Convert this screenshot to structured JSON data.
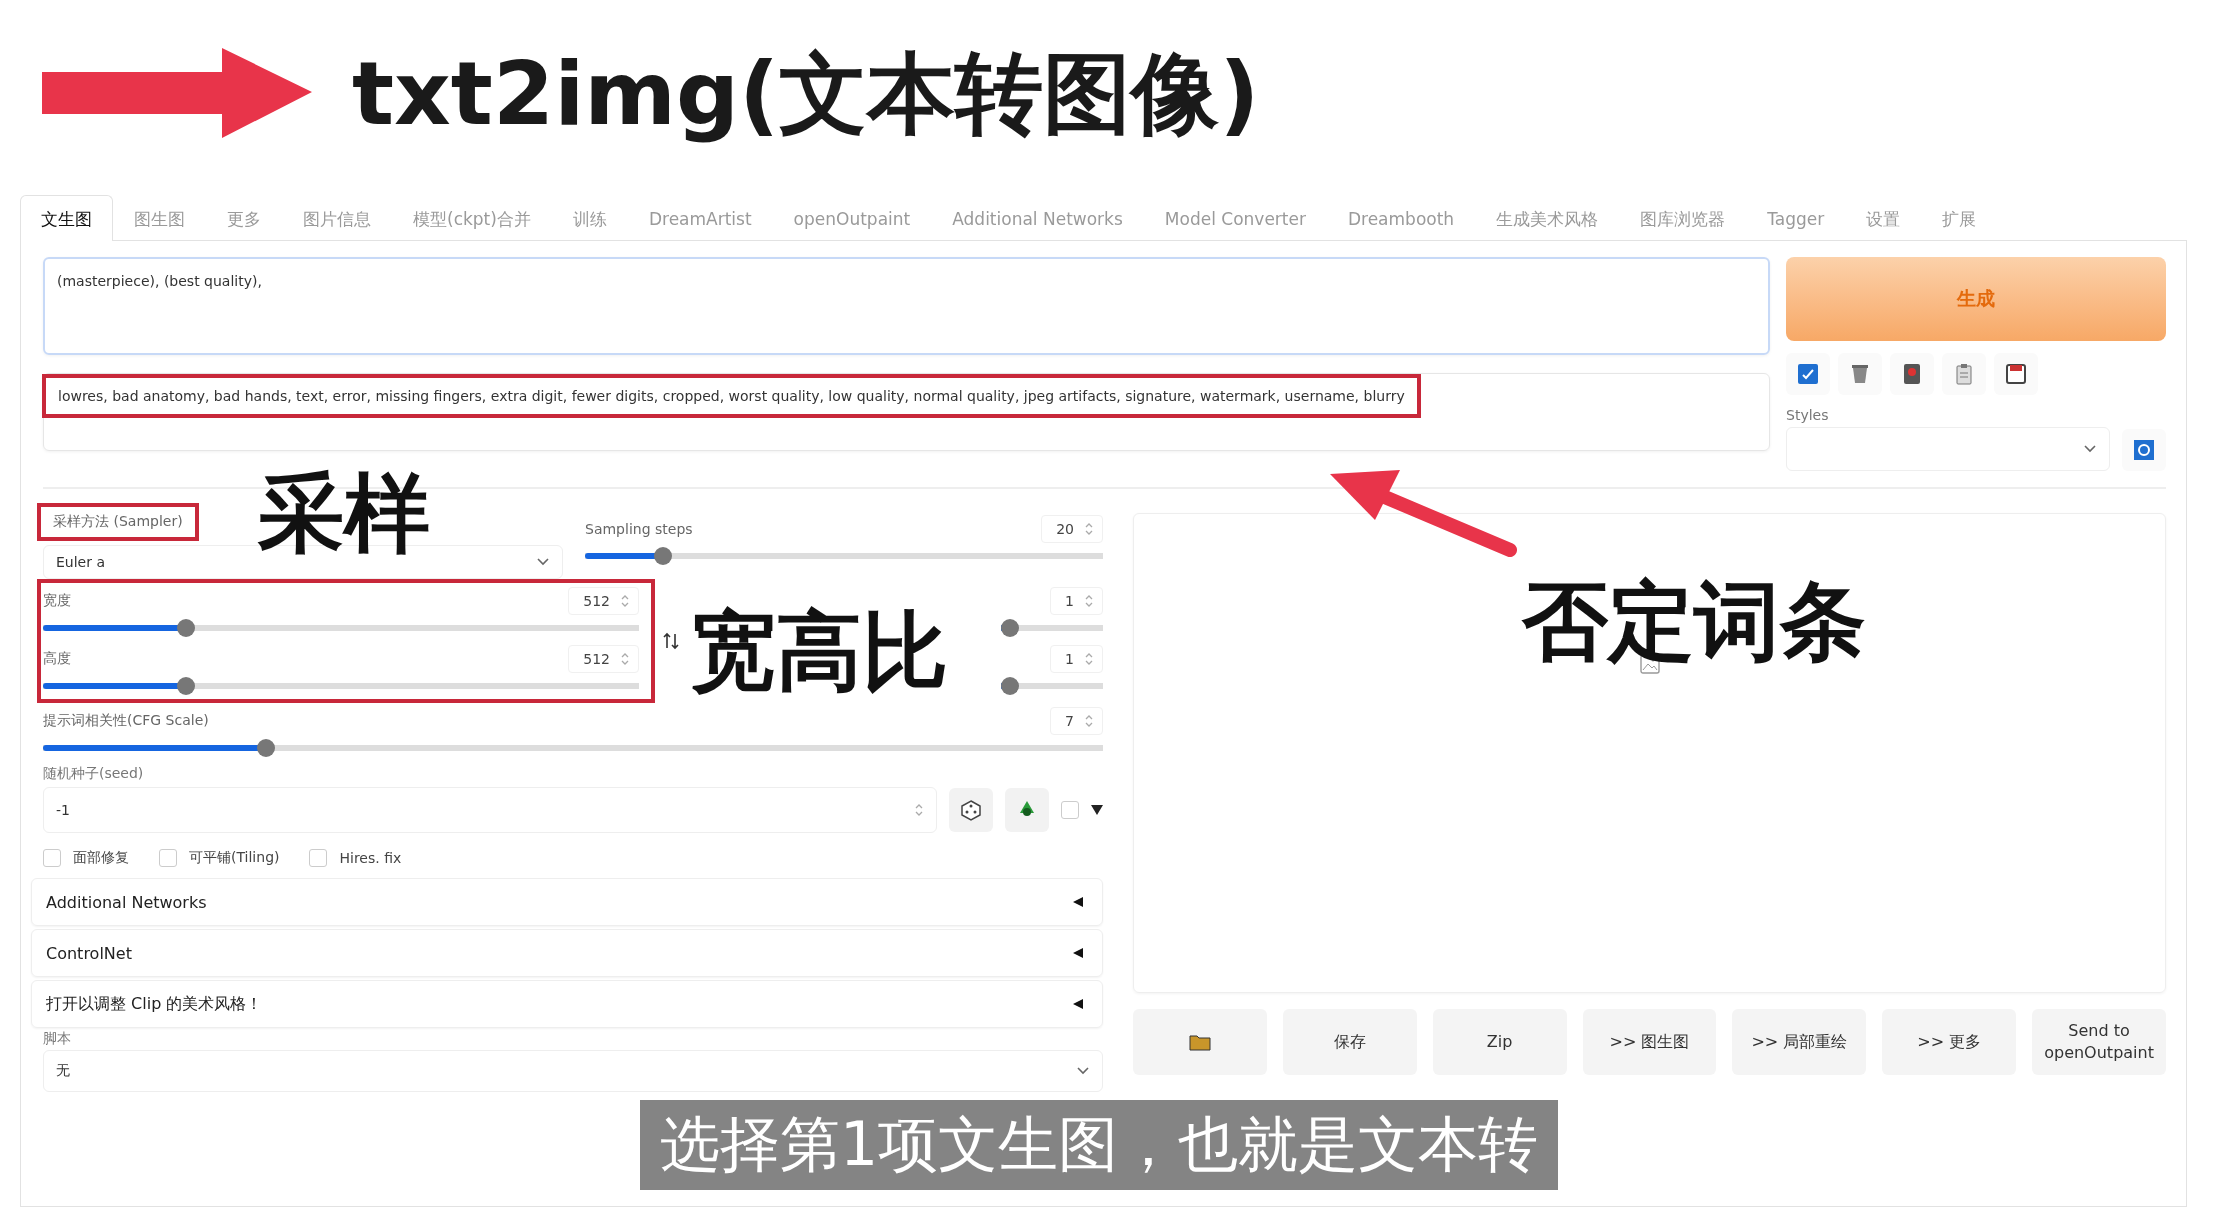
{
  "video_title": {
    "text": "txt2img(文本转图像)"
  },
  "tabs": [
    {
      "label": "文生图",
      "selected": true
    },
    {
      "label": "图生图",
      "selected": false
    },
    {
      "label": "更多",
      "selected": false
    },
    {
      "label": "图片信息",
      "selected": false
    },
    {
      "label": "模型(ckpt)合并",
      "selected": false
    },
    {
      "label": "训练",
      "selected": false
    },
    {
      "label": "DreamArtist",
      "selected": false
    },
    {
      "label": "openOutpaint",
      "selected": false
    },
    {
      "label": "Additional Networks",
      "selected": false
    },
    {
      "label": "Model Converter",
      "selected": false
    },
    {
      "label": "Dreambooth",
      "selected": false
    },
    {
      "label": "生成美术风格",
      "selected": false
    },
    {
      "label": "图库浏览器",
      "selected": false
    },
    {
      "label": "Tagger",
      "selected": false
    },
    {
      "label": "设置",
      "selected": false
    },
    {
      "label": "扩展",
      "selected": false
    }
  ],
  "prompt": {
    "value": "(masterpiece), (best quality),"
  },
  "negative_prompt": {
    "value": "lowres, bad anatomy, bad hands, text, error, missing fingers, extra digit, fewer digits, cropped, worst quality, low quality, normal quality, jpeg artifacts, signature, watermark, username, blurry",
    "highlighted": true
  },
  "generate_button": "生成",
  "styles": {
    "label": "Styles"
  },
  "sampler": {
    "label": "采样方法 (Sampler)",
    "value": "Euler a",
    "highlighted": true
  },
  "sampling_steps": {
    "label": "Sampling steps",
    "value": "20",
    "level": 0.15
  },
  "size": {
    "highlighted": true,
    "width": {
      "label": "宽度",
      "value": "512",
      "level": 0.24
    },
    "height": {
      "label": "高度",
      "value": "512",
      "level": 0.24
    }
  },
  "batch_count": {
    "value": "1",
    "level": 0.02
  },
  "batch_size": {
    "value": "1",
    "level": 0.02
  },
  "cfg_scale": {
    "label": "提示词相关性(CFG Scale)",
    "value": "7",
    "level": 0.21
  },
  "seed": {
    "label": "随机种子(seed)",
    "value": "-1",
    "extra_checked": false
  },
  "checkboxes": [
    {
      "label": "面部修复",
      "checked": false
    },
    {
      "label": "可平铺(Tiling)",
      "checked": false
    },
    {
      "label": "Hires. fix",
      "checked": false
    }
  ],
  "accordions": [
    {
      "title": "Additional Networks",
      "expanded": false
    },
    {
      "title": "ControlNet",
      "expanded": false
    },
    {
      "title": "打开以调整 Clip 的美术风格！",
      "expanded": false
    }
  ],
  "script": {
    "label": "脚本",
    "value": "无"
  },
  "output_buttons": [
    {
      "kind": "icon"
    },
    {
      "kind": "text",
      "label": "保存"
    },
    {
      "kind": "text",
      "label": "Zip"
    },
    {
      "kind": "text",
      "label": ">> 图生图"
    },
    {
      "kind": "text",
      "label": ">> 局部重绘"
    },
    {
      "kind": "text",
      "label": ">> 更多"
    },
    {
      "kind": "text",
      "label": "Send to openOutpaint"
    }
  ],
  "annotations": {
    "sampler_note": "采样",
    "size_note": "宽高比",
    "negative_note": "否定词条"
  },
  "subtitle": "选择第1项文生图，也就是文本转"
}
